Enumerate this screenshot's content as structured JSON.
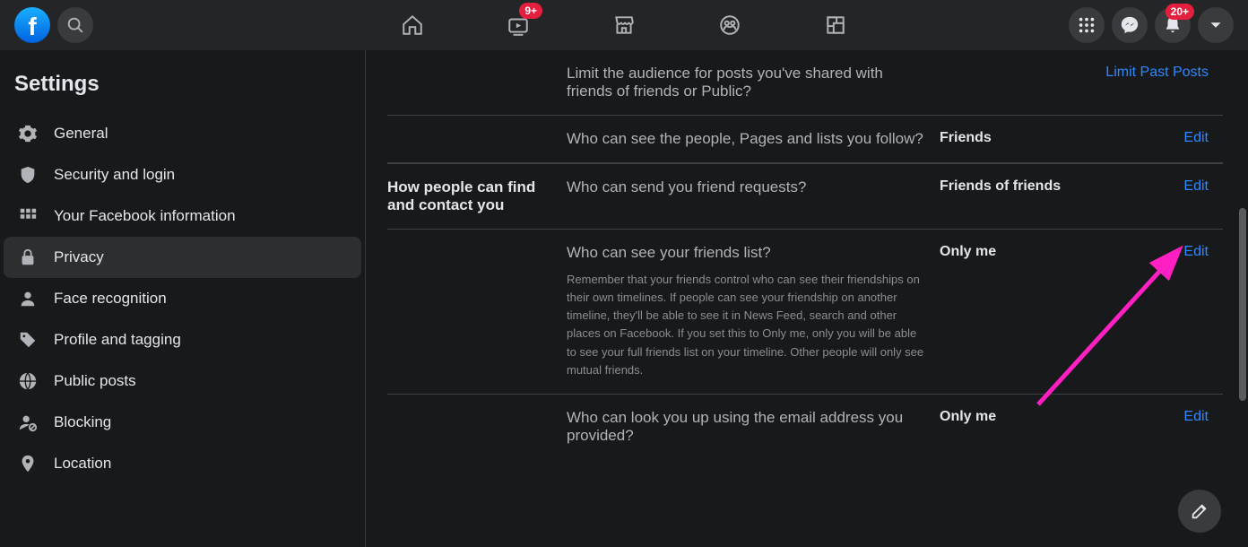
{
  "topbar": {
    "watch_badge": "9+",
    "notif_badge": "20+"
  },
  "sidebar": {
    "title": "Settings",
    "items": [
      {
        "label": "General"
      },
      {
        "label": "Security and login"
      },
      {
        "label": "Your Facebook information"
      },
      {
        "label": "Privacy"
      },
      {
        "label": "Face recognition"
      },
      {
        "label": "Profile and tagging"
      },
      {
        "label": "Public posts"
      },
      {
        "label": "Blocking"
      },
      {
        "label": "Location"
      }
    ]
  },
  "sections": {
    "contact_header": "How people can find and contact you"
  },
  "rows": {
    "limit": {
      "title": "Limit the audience for posts you've shared with friends of friends or Public?",
      "action": "Limit Past Posts"
    },
    "following": {
      "title": "Who can see the people, Pages and lists you follow?",
      "value": "Friends",
      "action": "Edit"
    },
    "friendreq": {
      "title": "Who can send you friend requests?",
      "value": "Friends of friends",
      "action": "Edit"
    },
    "friendslist": {
      "title": "Who can see your friends list?",
      "desc": "Remember that your friends control who can see their friendships on their own timelines. If people can see your friendship on another timeline, they'll be able to see it in News Feed, search and other places on Facebook. If you set this to Only me, only you will be able to see your full friends list on your timeline. Other people will only see mutual friends.",
      "value": "Only me",
      "action": "Edit"
    },
    "email": {
      "title": "Who can look you up using the email address you provided?",
      "value": "Only me",
      "action": "Edit"
    }
  }
}
